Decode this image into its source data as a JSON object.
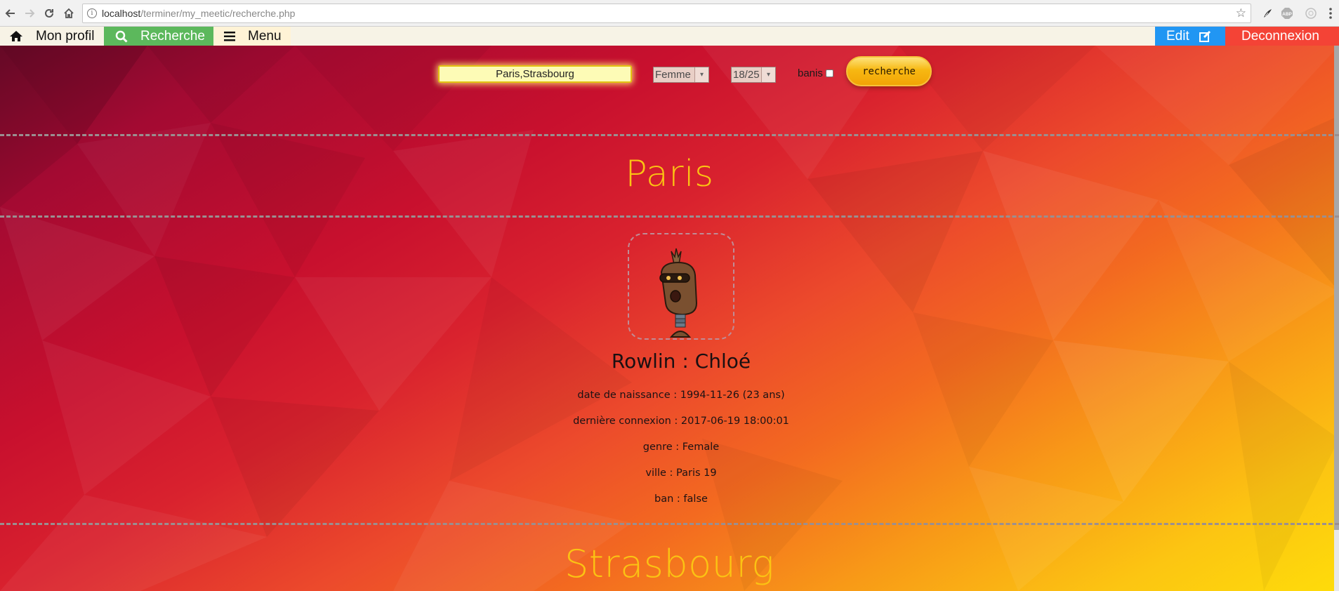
{
  "browser": {
    "url_host": "localhost",
    "url_path": "/terminer/my_meetic/recherche.php"
  },
  "nav": {
    "mon_profil": "Mon profil",
    "recherche": "Recherche",
    "menu": "Menu",
    "edit": "Edit",
    "deconnexion": "Deconnexion",
    "colors": {
      "recherche_bg": "#5cb85c",
      "menu_bg": "#fff3d6",
      "edit_bg": "#2196f3",
      "deconnexion_bg": "#f44336"
    }
  },
  "search": {
    "cities_value": "Paris,Strasbourg",
    "gender_selected": "Femme",
    "age_selected": "18/25",
    "banis_label": "banis",
    "banis_checked": false,
    "button_label": "recherche"
  },
  "results": {
    "city1": "Paris",
    "city2": "Strasbourg",
    "profile": {
      "name": "Rowlin : Chloé",
      "birth": "date de naissance : 1994-11-26 (23 ans)",
      "last_login": "dernière connexion : 2017-06-19 18:00:01",
      "gender": "genre : Female",
      "city": "ville : Paris 19",
      "ban": "ban : false"
    }
  },
  "colors": {
    "heading": "#fbc313",
    "button": "#f7b812"
  }
}
